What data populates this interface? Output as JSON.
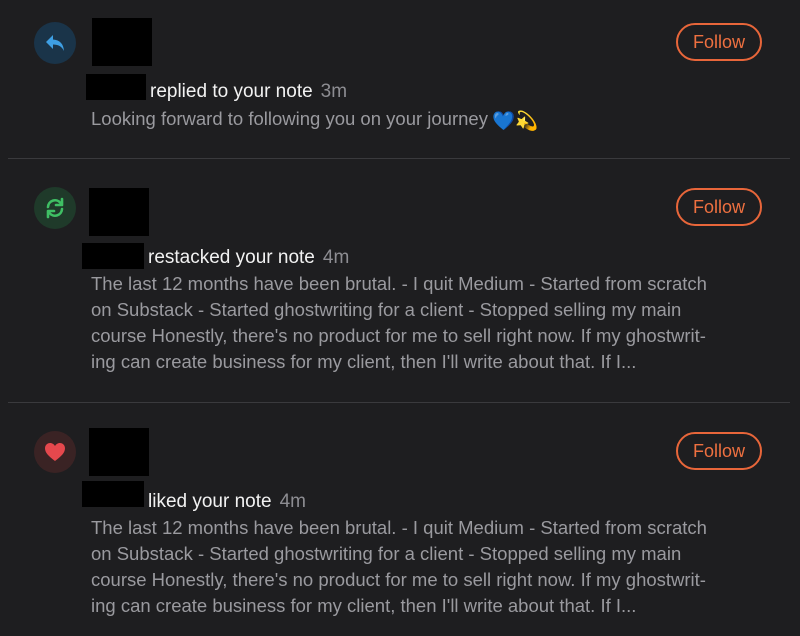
{
  "notifications": [
    {
      "type": "reply",
      "action_text": "replied to your note",
      "time": "3m",
      "body": "Looking forward to following you on your journey",
      "body_emoji": "💙💫",
      "follow_label": "Follow",
      "badge_color": "#1a3449",
      "icon_color": "#3e9fe3"
    },
    {
      "type": "restack",
      "action_text": "restacked your note",
      "time": "4m",
      "body_lines": [
        "The last 12 months have been brutal. - I quit Medium - Started from scratch",
        "on Substack - Started ghostwriting for a client - Stopped selling my main",
        "course Honestly, there's no product for me to sell right now. If my ghostwrit-",
        "ing can create business for my client, then I'll write about that. If I..."
      ],
      "follow_label": "Follow",
      "badge_color": "#1f3a2a",
      "icon_color": "#3fbf64"
    },
    {
      "type": "like",
      "action_text": "liked your note",
      "time": "4m",
      "body_lines": [
        "The last 12 months have been brutal. - I quit Medium - Started from scratch",
        "on Substack - Started ghostwriting for a client - Stopped selling my main",
        "course Honestly, there's no product for me to sell right now. If my ghostwrit-",
        "ing can create business for my client, then I'll write about that. If I..."
      ],
      "follow_label": "Follow",
      "badge_color": "#3a2324",
      "icon_color": "#e5484d"
    }
  ],
  "colors": {
    "background": "#1e1e20",
    "accent": "#ee7040",
    "divider": "#3a3a3d",
    "text_primary": "#f2f2f2",
    "text_secondary": "#9a9a9f"
  }
}
